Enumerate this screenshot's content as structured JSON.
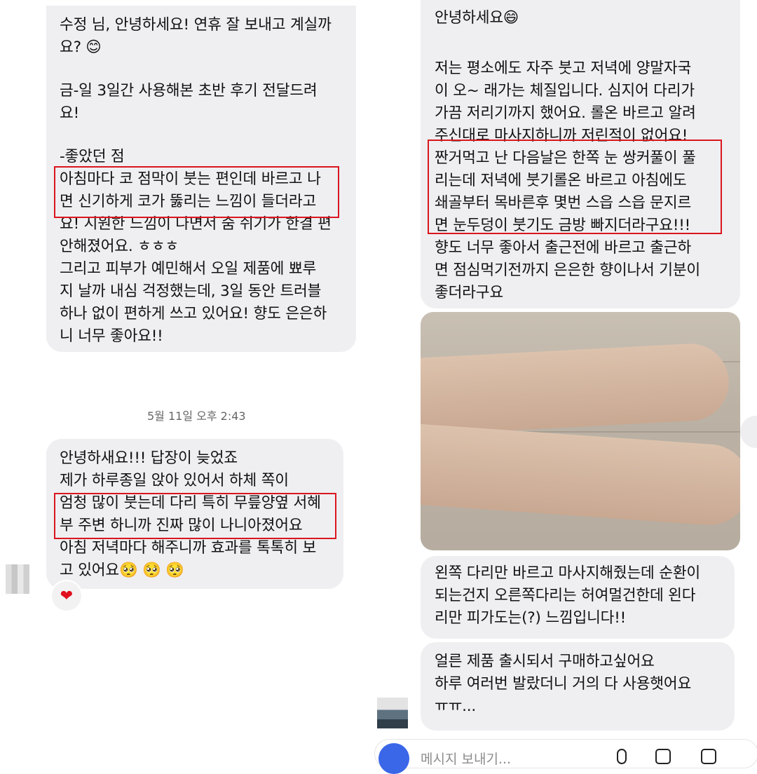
{
  "left": {
    "bubble1": [
      "수정 님, 안녕하세요! 연휴 잘 보내고 계실까",
      "요? 😊",
      "",
      "금-일 3일간 사용해본 초반 후기 전달드려",
      "요!",
      "",
      "-좋았던 점",
      "아침마다 코 점막이 붓는 편인데 바르고 나",
      "면 신기하게 코가 뚫리는 느낌이 들더라고",
      "요! 시원한 느낌이 나면서 숨 쉬기가 한결 편",
      "안해졌어요. ㅎㅎㅎ",
      "그리고 피부가 예민해서 오일 제품에 뾰루",
      "지 날까 내심 걱정했는데, 3일 동안 트러블",
      "하나 없이 편하게 쓰고 있어요! 향도 은은하",
      "니 너무 좋아요!!"
    ],
    "timestamp": "5월 11일 오후 2:43",
    "bubble2": [
      "안녕하새요!!! 답장이 늦었죠",
      "제가 하루종일 앉아 있어서 하체 쪽이",
      "엄청 많이 붓는데 다리 특히 무릎양옆 서혜",
      "부 주변 하니까 진짜 많이 나니아졌어요",
      "아침 저녁마다 해주니까 효과를 톡톡히 보",
      "고 있어요🥺 🥺 🥺"
    ],
    "reaction": "❤"
  },
  "right": {
    "bubble1": [
      "안녕하세요😄",
      "",
      "저는 평소에도 자주 붓고 저녁에 양말자국",
      "이 오~ 래가는 체질입니다. 심지어 다리가",
      "가끔 저리기까지 했어요. 롤온 바르고 알려",
      "주신대로 마사지하니까 저린적이 없어요!",
      "짠거먹고 난 다음날은 한쪽 눈 쌍커풀이 풀",
      "리는데 저녁에 붓기롤온 바르고 아침에도",
      "쇄골부터 목바른후 몇번 스읍 스읍 문지르",
      "면 눈두덩이 붓기도 금방 빠지더라구요!!!",
      "향도 너무 좋아서 출근전에 바르고 출근하",
      "면 점심먹기전까지 은은한 향이나서 기분이",
      "좋더라구요"
    ],
    "bubble2": [
      "왼쪽 다리만 바르고 마사지해줬는데 순환이",
      "되는건지 오른쪽다리는 허여멀건한데 왼다",
      "리만 피가도는(?) 느낌입니다!!"
    ],
    "bubble3": [
      "얼른 제품 출시되서 구매하고싶어요",
      "하루 여러번 발랐더니 거의 다 사용햇어요",
      "ㅠㅠ..."
    ],
    "input_placeholder": "메시지 보내기..."
  },
  "colors": {
    "bubble": "#efeff2",
    "highlight": "#d9161d",
    "camera": "#3a66e8"
  }
}
